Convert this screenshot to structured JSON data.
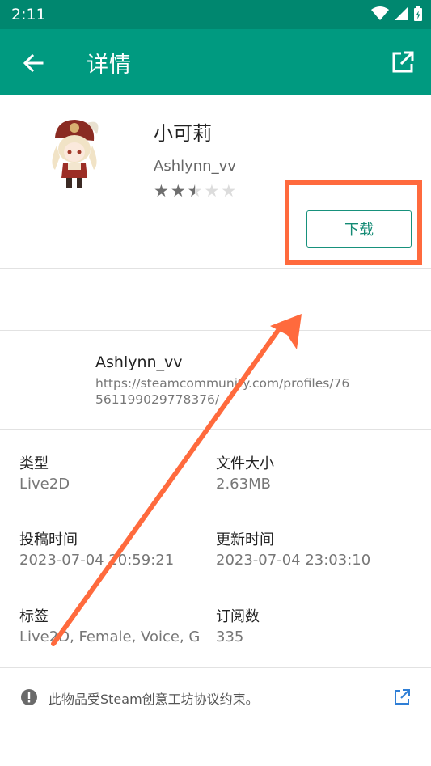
{
  "status_bar": {
    "time": "2:11",
    "icons": [
      "wifi-icon",
      "cell-signal-icon",
      "battery-charging-icon"
    ]
  },
  "app_bar": {
    "title": "详情",
    "back_icon": "arrow-left-icon",
    "action_icon": "open-external-icon"
  },
  "item": {
    "title": "小可莉",
    "author": "Ashlynn_vv",
    "rating": 2.5,
    "rating_max": 5,
    "download_label": "下载"
  },
  "author_block": {
    "name": "Ashlynn_vv",
    "url": "https://steamcommunity.com/profiles/76561199029778376/"
  },
  "info": {
    "type_label": "类型",
    "type_value": "Live2D",
    "size_label": "文件大小",
    "size_value": "2.63MB",
    "posted_label": "投稿时间",
    "posted_value": "2023-07-04 20:59:21",
    "updated_label": "更新时间",
    "updated_value": "2023-07-04 23:03:10",
    "tags_label": "标签",
    "tags_value": "Live2D, Female, Voice, G",
    "subs_label": "订阅数",
    "subs_value": "335"
  },
  "notice": {
    "text": "此物品受Steam创意工坊协议约束。",
    "icon": "info-alert-icon",
    "link_icon": "open-external-icon"
  },
  "colors": {
    "status_bar": "#00876f",
    "app_bar": "#009a80",
    "accent": "#138a74",
    "annotation": "#ff6a3d"
  }
}
